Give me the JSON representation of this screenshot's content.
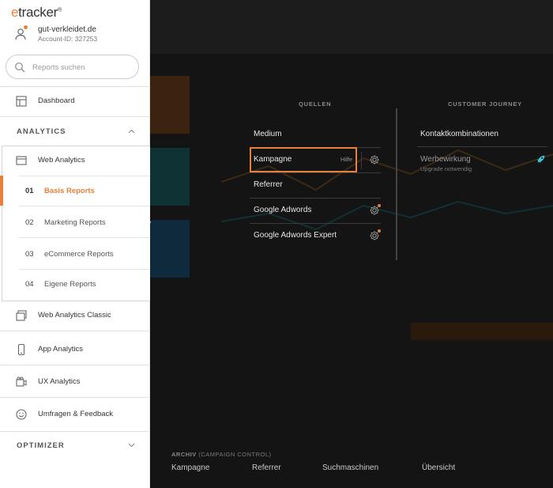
{
  "brand": {
    "logo_e": "e",
    "logo_rest": "tracker",
    "logo_mark": "®",
    "accent": "#e8803a"
  },
  "account": {
    "name": "gut-verkleidet.de",
    "id_text": "Account-ID: 327253"
  },
  "search": {
    "placeholder": "Reports suchen"
  },
  "sidebar": {
    "dashboard": "Dashboard",
    "analytics_title": "ANALYTICS",
    "web_analytics": "Web Analytics",
    "sub_items": [
      {
        "num": "01",
        "label": "Basis Reports"
      },
      {
        "num": "02",
        "label": "Marketing Reports"
      },
      {
        "num": "03",
        "label": "eCommerce Reports"
      },
      {
        "num": "04",
        "label": "Eigene Reports"
      }
    ],
    "items": [
      {
        "label": "Web Analytics Classic",
        "icon": "classic-icon"
      },
      {
        "label": "App Analytics",
        "icon": "phone-icon"
      },
      {
        "label": "UX Analytics",
        "icon": "video-icon"
      },
      {
        "label": "Umfragen & Feedback",
        "icon": "smiley-icon"
      }
    ],
    "optimizer_title": "OPTIMIZER"
  },
  "menu": {
    "quellen_title": "QUELLEN",
    "journey_title": "CUSTOMER JOURNEY",
    "quellen": [
      {
        "label": "Medium"
      },
      {
        "label": "Kampagne",
        "help": "Hilfe"
      },
      {
        "label": "Referrer"
      },
      {
        "label": "Google Adwords"
      },
      {
        "label": "Google Adwords Expert"
      }
    ],
    "journey": [
      {
        "label": "Kontaktkombinationen"
      },
      {
        "label": "Werbewirkung",
        "note": "Upgrade notwendig"
      }
    ]
  },
  "archive": {
    "title": "ARCHIV",
    "subtitle": "(CAMPAIGN CONTROL)",
    "links": [
      "Kampagne",
      "Referrer",
      "Suchmaschinen",
      "Übersicht"
    ]
  }
}
